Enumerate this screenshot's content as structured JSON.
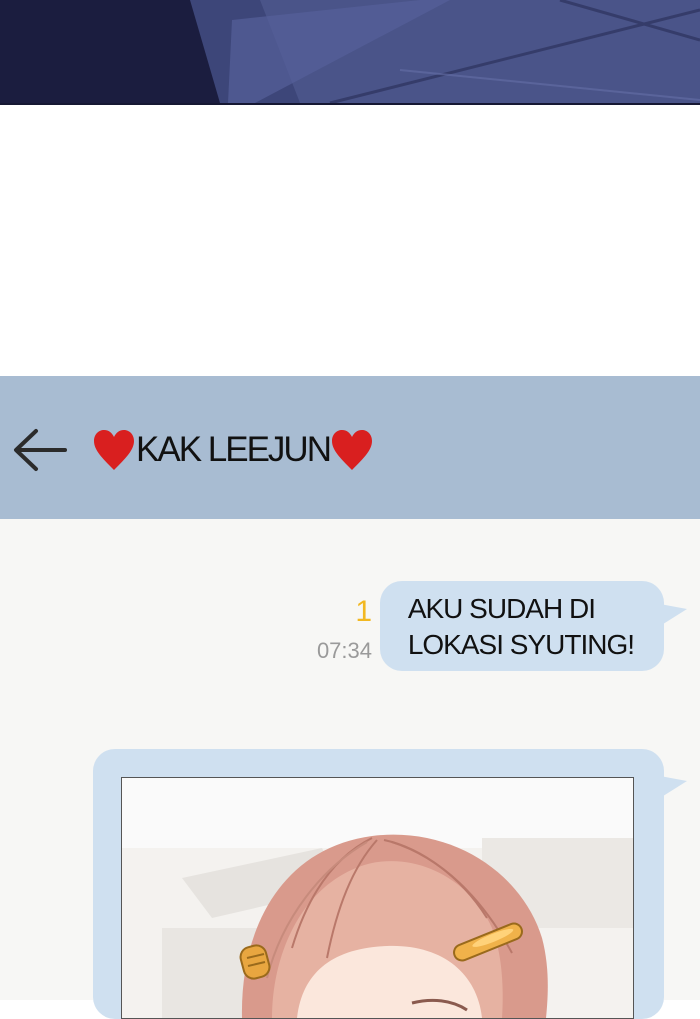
{
  "colors": {
    "header_bg": "#a8bcd2",
    "chat_bg": "#f7f7f5",
    "bubble_bg": "#cfe0f0",
    "read_indicator": "#f2b821",
    "timestamp": "#9a9a9a",
    "heart": "#d91f1f",
    "top_art": "#1f2247"
  },
  "header": {
    "back_icon": "arrow-left-icon",
    "contact_name": "KAK LEEJUN",
    "name_decoration_icon": "heart-icon"
  },
  "messages": [
    {
      "side": "right",
      "type": "text",
      "text": "AKU SUDAH DI\nLOKASI SYUTING!",
      "unread_count": "1",
      "time": "07:34"
    },
    {
      "side": "right",
      "type": "photo",
      "photo_subject": "girl with pink hair and hair clips"
    }
  ]
}
